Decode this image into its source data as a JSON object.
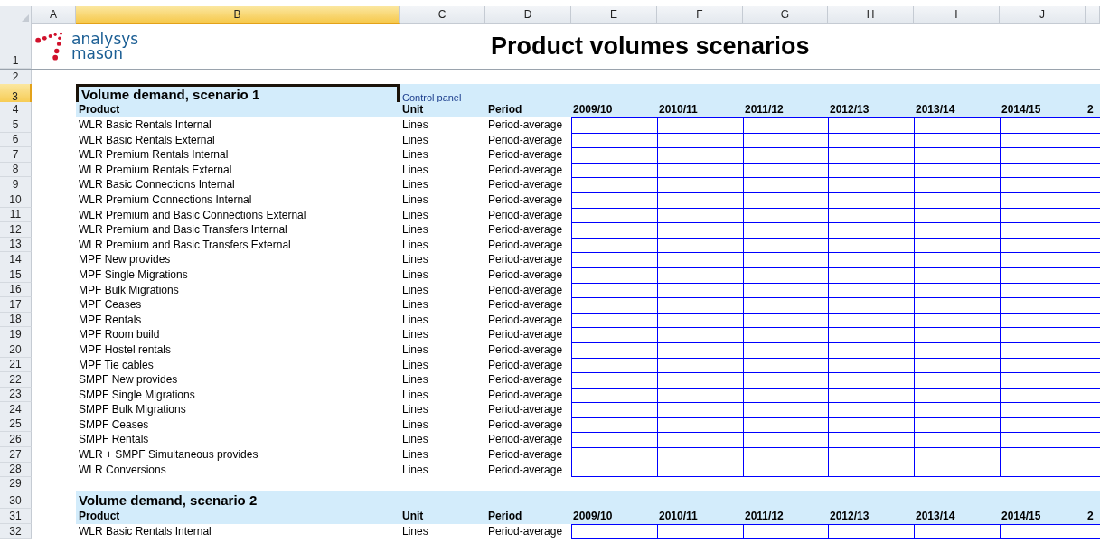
{
  "columns": [
    {
      "letter": "A",
      "selected": false
    },
    {
      "letter": "B",
      "selected": true
    },
    {
      "letter": "C",
      "selected": false
    },
    {
      "letter": "D",
      "selected": false
    },
    {
      "letter": "E",
      "selected": false
    },
    {
      "letter": "F",
      "selected": false
    },
    {
      "letter": "G",
      "selected": false
    },
    {
      "letter": "H",
      "selected": false
    },
    {
      "letter": "I",
      "selected": false
    },
    {
      "letter": "J",
      "selected": false
    }
  ],
  "rows": [
    {
      "number": "1",
      "selected": false,
      "kind": "logo",
      "logo": [
        "analysys",
        "mason"
      ],
      "heading": "Product volumes scenarios"
    },
    {
      "number": "2",
      "selected": false,
      "kind": "blank"
    },
    {
      "number": "3",
      "selected": true,
      "kind": "title",
      "title": "Volume demand, scenario 1",
      "link": "Control panel"
    },
    {
      "number": "4",
      "selected": false,
      "kind": "header",
      "product": "Product",
      "unit": "Unit",
      "period": "Period",
      "years": [
        "2009/10",
        "2010/11",
        "2011/12",
        "2012/13",
        "2013/14",
        "2014/15",
        "2"
      ]
    },
    {
      "number": "5",
      "selected": false,
      "kind": "data",
      "product": "WLR Basic Rentals Internal",
      "unit": "Lines",
      "period": "Period-average"
    },
    {
      "number": "6",
      "selected": false,
      "kind": "data",
      "product": "WLR Basic Rentals External",
      "unit": "Lines",
      "period": "Period-average"
    },
    {
      "number": "7",
      "selected": false,
      "kind": "data",
      "product": "WLR Premium Rentals Internal",
      "unit": "Lines",
      "period": "Period-average"
    },
    {
      "number": "8",
      "selected": false,
      "kind": "data",
      "product": "WLR Premium Rentals External",
      "unit": "Lines",
      "period": "Period-average"
    },
    {
      "number": "9",
      "selected": false,
      "kind": "data",
      "product": "WLR Basic Connections Internal",
      "unit": "Lines",
      "period": "Period-average"
    },
    {
      "number": "10",
      "selected": false,
      "kind": "data",
      "product": "WLR Premium Connections Internal",
      "unit": "Lines",
      "period": "Period-average"
    },
    {
      "number": "11",
      "selected": false,
      "kind": "data",
      "product": "WLR Premium and Basic Connections External",
      "unit": "Lines",
      "period": "Period-average"
    },
    {
      "number": "12",
      "selected": false,
      "kind": "data",
      "product": "WLR Premium and Basic Transfers Internal",
      "unit": "Lines",
      "period": "Period-average"
    },
    {
      "number": "13",
      "selected": false,
      "kind": "data",
      "product": "WLR Premium and Basic Transfers External",
      "unit": "Lines",
      "period": "Period-average"
    },
    {
      "number": "14",
      "selected": false,
      "kind": "data",
      "product": "MPF New provides",
      "unit": "Lines",
      "period": "Period-average"
    },
    {
      "number": "15",
      "selected": false,
      "kind": "data",
      "product": "MPF Single Migrations",
      "unit": "Lines",
      "period": "Period-average"
    },
    {
      "number": "16",
      "selected": false,
      "kind": "data",
      "product": "MPF Bulk Migrations",
      "unit": "Lines",
      "period": "Period-average"
    },
    {
      "number": "17",
      "selected": false,
      "kind": "data",
      "product": "MPF Ceases",
      "unit": "Lines",
      "period": "Period-average"
    },
    {
      "number": "18",
      "selected": false,
      "kind": "data",
      "product": "MPF Rentals",
      "unit": "Lines",
      "period": "Period-average"
    },
    {
      "number": "19",
      "selected": false,
      "kind": "data",
      "product": "MPF Room build",
      "unit": "Lines",
      "period": "Period-average"
    },
    {
      "number": "20",
      "selected": false,
      "kind": "data",
      "product": "MPF Hostel rentals",
      "unit": "Lines",
      "period": "Period-average"
    },
    {
      "number": "21",
      "selected": false,
      "kind": "data",
      "product": "MPF Tie cables",
      "unit": "Lines",
      "period": "Period-average"
    },
    {
      "number": "22",
      "selected": false,
      "kind": "data",
      "product": "SMPF New provides",
      "unit": "Lines",
      "period": "Period-average"
    },
    {
      "number": "23",
      "selected": false,
      "kind": "data",
      "product": "SMPF Single Migrations",
      "unit": "Lines",
      "period": "Period-average"
    },
    {
      "number": "24",
      "selected": false,
      "kind": "data",
      "product": "SMPF Bulk Migrations",
      "unit": "Lines",
      "period": "Period-average"
    },
    {
      "number": "25",
      "selected": false,
      "kind": "data",
      "product": "SMPF Ceases",
      "unit": "Lines",
      "period": "Period-average"
    },
    {
      "number": "26",
      "selected": false,
      "kind": "data",
      "product": "SMPF Rentals",
      "unit": "Lines",
      "period": "Period-average"
    },
    {
      "number": "27",
      "selected": false,
      "kind": "data",
      "product": "WLR + SMPF Simultaneous provides",
      "unit": "Lines",
      "period": "Period-average"
    },
    {
      "number": "28",
      "selected": false,
      "kind": "data",
      "product": "WLR Conversions",
      "unit": "Lines",
      "period": "Period-average"
    },
    {
      "number": "29",
      "selected": false,
      "kind": "blank"
    },
    {
      "number": "30",
      "selected": false,
      "kind": "title",
      "title": "Volume demand, scenario 2"
    },
    {
      "number": "31",
      "selected": false,
      "kind": "header",
      "product": "Product",
      "unit": "Unit",
      "period": "Period",
      "years": [
        "2009/10",
        "2010/11",
        "2011/12",
        "2012/13",
        "2013/14",
        "2014/15",
        "2"
      ]
    },
    {
      "number": "32",
      "selected": false,
      "kind": "data",
      "product": "WLR Basic Rentals Internal",
      "unit": "Lines",
      "period": "Period-average"
    }
  ]
}
